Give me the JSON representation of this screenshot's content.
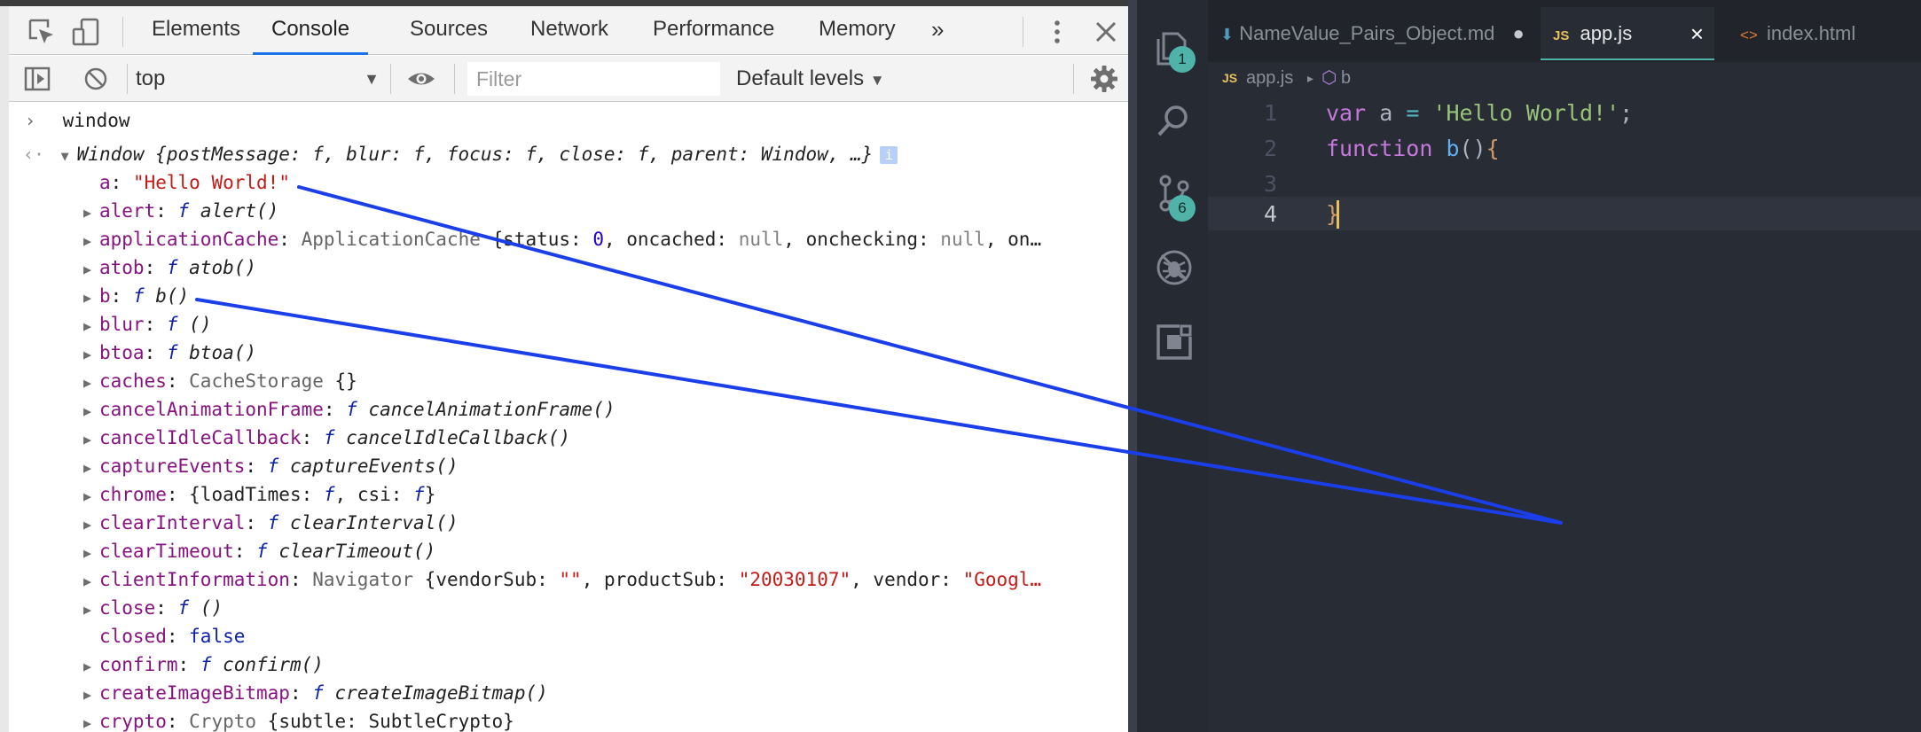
{
  "devtools": {
    "tabs": [
      "Elements",
      "Console",
      "Sources",
      "Network",
      "Performance",
      "Memory"
    ],
    "more_label": "»",
    "context_select": "top",
    "filter_placeholder": "Filter",
    "default_levels": "Default levels",
    "console": {
      "input": "window",
      "object_summary": {
        "class": "Window",
        "preview": "{postMessage: f, blur: f, focus: f, close: f, parent: Window, …}"
      },
      "props": [
        {
          "key": "a",
          "sep": ": ",
          "parts": [
            {
              "t": "\"Hello World!\"",
              "c": "str"
            }
          ],
          "expandable": false
        },
        {
          "key": "alert",
          "sep": ": ",
          "parts": [
            {
              "t": "f ",
              "c": "fsym"
            },
            {
              "t": "alert()",
              "c": "ital"
            }
          ],
          "expandable": true
        },
        {
          "key": "applicationCache",
          "sep": ": ",
          "parts": [
            {
              "t": "ApplicationCache ",
              "c": "cls"
            },
            {
              "t": "{status: ",
              "c": "plain"
            },
            {
              "t": "0",
              "c": "num"
            },
            {
              "t": ", oncached: ",
              "c": "plain"
            },
            {
              "t": "null",
              "c": "nul"
            },
            {
              "t": ", onchecking: ",
              "c": "plain"
            },
            {
              "t": "null",
              "c": "nul"
            },
            {
              "t": ", on…",
              "c": "plain"
            }
          ],
          "expandable": true
        },
        {
          "key": "atob",
          "sep": ": ",
          "parts": [
            {
              "t": "f ",
              "c": "fsym"
            },
            {
              "t": "atob()",
              "c": "ital"
            }
          ],
          "expandable": true
        },
        {
          "key": "b",
          "sep": ": ",
          "parts": [
            {
              "t": "f ",
              "c": "fsym"
            },
            {
              "t": "b()",
              "c": "ital"
            }
          ],
          "expandable": true
        },
        {
          "key": "blur",
          "sep": ": ",
          "parts": [
            {
              "t": "f ",
              "c": "fsym"
            },
            {
              "t": "()",
              "c": "ital"
            }
          ],
          "expandable": true
        },
        {
          "key": "btoa",
          "sep": ": ",
          "parts": [
            {
              "t": "f ",
              "c": "fsym"
            },
            {
              "t": "btoa()",
              "c": "ital"
            }
          ],
          "expandable": true
        },
        {
          "key": "caches",
          "sep": ": ",
          "parts": [
            {
              "t": "CacheStorage ",
              "c": "cls"
            },
            {
              "t": "{}",
              "c": "plain"
            }
          ],
          "expandable": true
        },
        {
          "key": "cancelAnimationFrame",
          "sep": ": ",
          "parts": [
            {
              "t": "f ",
              "c": "fsym"
            },
            {
              "t": "cancelAnimationFrame()",
              "c": "ital"
            }
          ],
          "expandable": true
        },
        {
          "key": "cancelIdleCallback",
          "sep": ": ",
          "parts": [
            {
              "t": "f ",
              "c": "fsym"
            },
            {
              "t": "cancelIdleCallback()",
              "c": "ital"
            }
          ],
          "expandable": true
        },
        {
          "key": "captureEvents",
          "sep": ": ",
          "parts": [
            {
              "t": "f ",
              "c": "fsym"
            },
            {
              "t": "captureEvents()",
              "c": "ital"
            }
          ],
          "expandable": true
        },
        {
          "key": "chrome",
          "sep": ": ",
          "parts": [
            {
              "t": "{loadTimes: ",
              "c": "plain"
            },
            {
              "t": "f",
              "c": "fsym"
            },
            {
              "t": ", csi: ",
              "c": "plain"
            },
            {
              "t": "f",
              "c": "fsym"
            },
            {
              "t": "}",
              "c": "plain"
            }
          ],
          "expandable": true
        },
        {
          "key": "clearInterval",
          "sep": ": ",
          "parts": [
            {
              "t": "f ",
              "c": "fsym"
            },
            {
              "t": "clearInterval()",
              "c": "ital"
            }
          ],
          "expandable": true
        },
        {
          "key": "clearTimeout",
          "sep": ": ",
          "parts": [
            {
              "t": "f ",
              "c": "fsym"
            },
            {
              "t": "clearTimeout()",
              "c": "ital"
            }
          ],
          "expandable": true
        },
        {
          "key": "clientInformation",
          "sep": ": ",
          "parts": [
            {
              "t": "Navigator ",
              "c": "cls"
            },
            {
              "t": "{vendorSub: ",
              "c": "plain"
            },
            {
              "t": "\"\"",
              "c": "str"
            },
            {
              "t": ", productSub: ",
              "c": "plain"
            },
            {
              "t": "\"20030107\"",
              "c": "str"
            },
            {
              "t": ", vendor: ",
              "c": "plain"
            },
            {
              "t": "\"Googl…",
              "c": "str"
            }
          ],
          "expandable": true
        },
        {
          "key": "close",
          "sep": ": ",
          "parts": [
            {
              "t": "f ",
              "c": "fsym"
            },
            {
              "t": "()",
              "c": "ital"
            }
          ],
          "expandable": true
        },
        {
          "key": "closed",
          "sep": ": ",
          "parts": [
            {
              "t": "false",
              "c": "kw"
            }
          ],
          "expandable": false
        },
        {
          "key": "confirm",
          "sep": ": ",
          "parts": [
            {
              "t": "f ",
              "c": "fsym"
            },
            {
              "t": "confirm()",
              "c": "ital"
            }
          ],
          "expandable": true
        },
        {
          "key": "createImageBitmap",
          "sep": ": ",
          "parts": [
            {
              "t": "f ",
              "c": "fsym"
            },
            {
              "t": "createImageBitmap()",
              "c": "ital"
            }
          ],
          "expandable": true
        },
        {
          "key": "crypto",
          "sep": ": ",
          "parts": [
            {
              "t": "Crypto ",
              "c": "cls"
            },
            {
              "t": "{subtle: SubtleCrypto}",
              "c": "plain"
            }
          ],
          "expandable": true
        }
      ]
    }
  },
  "vscode": {
    "tabs": [
      {
        "name": "NameValue_Pairs_Object.md",
        "modified": true,
        "active": false,
        "icon": "markdown-arrow-icon"
      },
      {
        "name": "app.js",
        "active": true,
        "icon": "js-icon",
        "close": "×",
        "badge": "JS"
      },
      {
        "name": "index.html",
        "active": false,
        "icon": "html-icon",
        "badge": "<>"
      }
    ],
    "breadcrumb": {
      "badge": "JS",
      "file": "app.js",
      "symbol": "b"
    },
    "activity_badges": {
      "explorer": "1",
      "scm": "6"
    },
    "code": {
      "line_numbers": [
        "1",
        "2",
        "3",
        "4"
      ],
      "line1": {
        "kw": "var",
        "id": " a ",
        "op": "=",
        "str": " 'Hello World!'",
        "end": ";"
      },
      "line2": {
        "kw": "function",
        "fn": " b",
        "paren": "()",
        "brace": "{"
      },
      "line4": {
        "brace": "}"
      }
    }
  },
  "annotation_color": "#1a3ee8"
}
